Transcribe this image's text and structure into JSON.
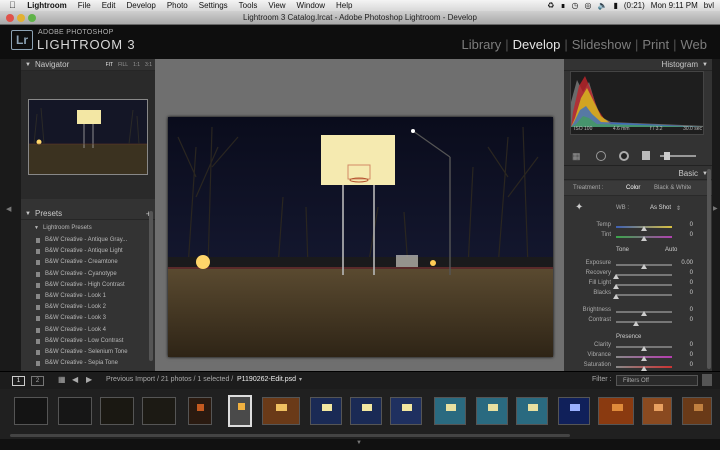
{
  "menubar": {
    "apple": "",
    "items": [
      "Lightroom",
      "File",
      "Edit",
      "Develop",
      "Photo",
      "Settings",
      "Tools",
      "View",
      "Window",
      "Help"
    ],
    "battery": "(0:21)",
    "clock": "Mon 9:11 PM",
    "user": "bvl"
  },
  "window_title": "Lightroom 3 Catalog.lrcat - Adobe Photoshop Lightroom - Develop",
  "brand": {
    "small": "ADOBE PHOTOSHOP",
    "big": "LIGHTROOM 3",
    "logo": "Lr"
  },
  "modules": [
    "Library",
    "Develop",
    "Slideshow",
    "Print",
    "Web"
  ],
  "active_module": "Develop",
  "navigator": {
    "title": "Navigator",
    "options": [
      "FIT",
      "FILL",
      "1:1",
      "3:1"
    ]
  },
  "presets": {
    "title": "Presets",
    "add": "+",
    "folder": "Lightroom Presets",
    "items": [
      "B&W Creative - Antique Gray...",
      "B&W Creative - Antique Light",
      "B&W Creative - Creamtone",
      "B&W Creative - Cyanotype",
      "B&W Creative - High Contrast",
      "B&W Creative - Look 1",
      "B&W Creative - Look 2",
      "B&W Creative - Look 3",
      "B&W Creative - Look 4",
      "B&W Creative - Low Contrast",
      "B&W Creative - Selenium Tone",
      "B&W Creative - Sepia Tone"
    ]
  },
  "histogram": {
    "title": "Histogram",
    "iso": "ISO 100",
    "focal": "4.6 mm",
    "aperture": "f / 3.2",
    "shutter": "30.0 sec"
  },
  "basic": {
    "title": "Basic",
    "treatment_label": "Treatment :",
    "treatment_color": "Color",
    "treatment_bw": "Black & White",
    "wb_label": "WB :",
    "wb_value": "As Shot",
    "tone_label": "Tone",
    "auto": "Auto",
    "presence_label": "Presence",
    "sliders": [
      {
        "label": "Temp",
        "value": "0",
        "pos": 0.5
      },
      {
        "label": "Tint",
        "value": "0",
        "pos": 0.5
      },
      {
        "label": "Exposure",
        "value": "0.00",
        "pos": 0.5
      },
      {
        "label": "Recovery",
        "value": "0",
        "pos": 0.0
      },
      {
        "label": "Fill Light",
        "value": "0",
        "pos": 0.0
      },
      {
        "label": "Blacks",
        "value": "0",
        "pos": 0.0
      },
      {
        "label": "Brightness",
        "value": "0",
        "pos": 0.5
      },
      {
        "label": "Contrast",
        "value": "0",
        "pos": 0.35
      },
      {
        "label": "Clarity",
        "value": "0",
        "pos": 0.5
      },
      {
        "label": "Vibrance",
        "value": "0",
        "pos": 0.5
      },
      {
        "label": "Saturation",
        "value": "0",
        "pos": 0.5
      }
    ]
  },
  "filmstrip": {
    "page1": "1",
    "page2": "2",
    "source": "Previous Import / 21 photos / 1 selected /",
    "filename": "P1190262-Edit.psd",
    "filter_label": "Filter :",
    "filter_value": "Filters Off"
  },
  "colors": {
    "accent": "#e6e6e6",
    "panel": "#333333",
    "center": "#6f6f6f"
  }
}
